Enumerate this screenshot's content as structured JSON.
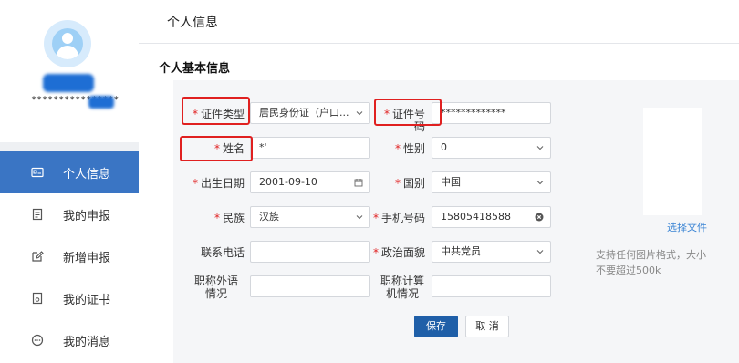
{
  "profile": {
    "masked_id": "****************"
  },
  "menu": [
    {
      "label": "个人信息",
      "icon": "id-card-icon",
      "active": true
    },
    {
      "label": "我的申报",
      "icon": "document-icon",
      "active": false
    },
    {
      "label": "新增申报",
      "icon": "edit-icon",
      "active": false
    },
    {
      "label": "我的证书",
      "icon": "certificate-icon",
      "active": false
    },
    {
      "label": "我的消息",
      "icon": "message-icon",
      "active": false
    }
  ],
  "header": {
    "title": "个人信息"
  },
  "section": {
    "title": "个人基本信息"
  },
  "form": {
    "id_type": {
      "label": "证件类型",
      "value": "居民身份证（户口..."
    },
    "id_number": {
      "label": "证件号码",
      "value": "*************"
    },
    "name": {
      "label": "姓名",
      "value": "*'"
    },
    "gender": {
      "label": "性别",
      "value": "0"
    },
    "birth_date": {
      "label": "出生日期",
      "value": "2001-09-10"
    },
    "nationality": {
      "label": "国别",
      "value": "中国"
    },
    "ethnicity": {
      "label": "民族",
      "value": "汉族"
    },
    "phone": {
      "label": "手机号码",
      "value": "15805418588"
    },
    "contact_phone": {
      "label": "联系电话",
      "value": ""
    },
    "political_status": {
      "label": "政治面貌",
      "value": "中共党员"
    },
    "title_foreign_language": {
      "label_line1": "职称外语",
      "label_line2": "情况",
      "value": ""
    },
    "title_computer": {
      "label_line1": "职称计算",
      "label_line2": "机情况",
      "value": ""
    }
  },
  "upload": {
    "link": "选择文件",
    "hint": "支持任何图片格式，大小不要超过500k"
  },
  "buttons": {
    "save": "保存",
    "cancel": "取 消"
  },
  "colors": {
    "accent": "#3a75c4",
    "required": "#e02020",
    "save_button": "#1f5fa8",
    "highlight_box": "#e02020"
  }
}
